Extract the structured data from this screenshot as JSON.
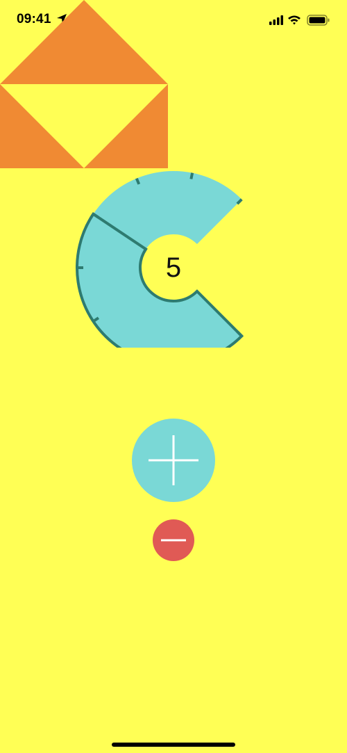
{
  "status_bar": {
    "time": "09:41",
    "location_icon": "location-arrow-icon",
    "signal_icon": "cellular-signal-icon",
    "wifi_icon": "wifi-icon",
    "battery_icon": "battery-icon"
  },
  "gauge": {
    "value": "5",
    "level": 5,
    "max": 8
  },
  "controls": {
    "increment_icon": "plus-icon",
    "decrement_icon": "minus-icon"
  },
  "colors": {
    "background": "#FFFF55",
    "shape_accent": "#F08A33",
    "gauge_fill": "#7AD8D6",
    "gauge_stroke": "#2E7B70",
    "increment_button": "#7AD8D6",
    "decrement_button": "#E05A55",
    "icon_stroke": "#FFFFFF"
  }
}
